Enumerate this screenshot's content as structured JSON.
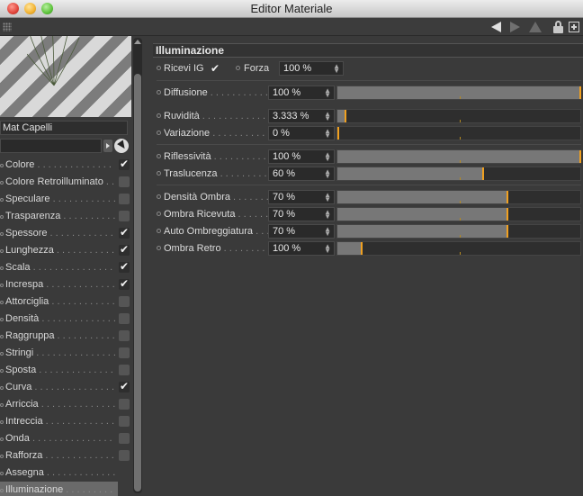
{
  "window": {
    "title": "Editor Materiale"
  },
  "material": {
    "name": "Mat Capelli"
  },
  "channels": [
    {
      "label": "Colore",
      "checked": true
    },
    {
      "label": "Colore Retroilluminato",
      "checked": false
    },
    {
      "label": "Speculare",
      "checked": false
    },
    {
      "label": "Trasparenza",
      "checked": false
    },
    {
      "label": "Spessore",
      "checked": true
    },
    {
      "label": "Lunghezza",
      "checked": true
    },
    {
      "label": "Scala",
      "checked": true
    },
    {
      "label": "Increspa",
      "checked": true
    },
    {
      "label": "Attorciglia",
      "checked": false
    },
    {
      "label": "Densità",
      "checked": false
    },
    {
      "label": "Raggruppa",
      "checked": false
    },
    {
      "label": "Stringi",
      "checked": false
    },
    {
      "label": "Sposta",
      "checked": false
    },
    {
      "label": "Curva",
      "checked": true
    },
    {
      "label": "Arriccia",
      "checked": false
    },
    {
      "label": "Intreccia",
      "checked": false
    },
    {
      "label": "Onda",
      "checked": false
    },
    {
      "label": "Rafforza",
      "checked": false
    },
    {
      "label": "Assegna",
      "checked": null
    },
    {
      "label": "Illuminazione",
      "checked": null,
      "selected": true
    }
  ],
  "section": {
    "title": "Illuminazione"
  },
  "illumination": {
    "ricevi_ig_label": "Ricevi IG",
    "ricevi_ig_checked": true,
    "forza_label": "Forza",
    "forza_value": "100 %",
    "params": [
      {
        "label": "Diffusione",
        "value": "100 %",
        "level": 1.0
      },
      {
        "label": "Ruvidità",
        "value": "3.333 %",
        "level": 0.033
      },
      {
        "label": "Variazione",
        "value": "0 %",
        "level": 0.0
      },
      {
        "label": "Riflessività",
        "value": "100 %",
        "level": 1.0
      },
      {
        "label": "Traslucenza",
        "value": "60 %",
        "level": 0.6
      },
      {
        "label": "Densità Ombra",
        "value": "70 %",
        "level": 0.7
      },
      {
        "label": "Ombra Ricevuta",
        "value": "70 %",
        "level": 0.7
      },
      {
        "label": "Auto Ombreggiatura",
        "value": "70 %",
        "level": 0.7
      },
      {
        "label": "Ombra Retro",
        "value": "100 %",
        "level": 0.1
      }
    ]
  },
  "colors": {
    "accent": "#f0a020",
    "slider_fill": "#777777",
    "background": "#3a3a3a"
  }
}
